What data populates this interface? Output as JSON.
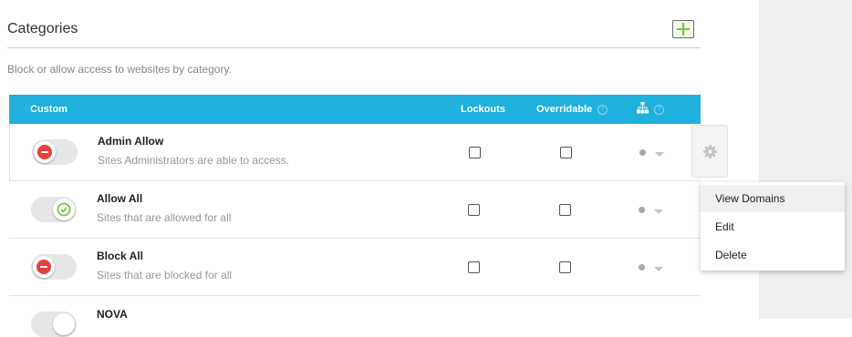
{
  "section": {
    "title": "Categories",
    "description": "Block or allow access to websites by category."
  },
  "table": {
    "columns": {
      "custom": "Custom",
      "lockouts": "Lockouts",
      "overridable": "Overridable"
    },
    "rows": [
      {
        "name": "Admin Allow",
        "description": "Sites Administrators are able to access.",
        "toggle": "block"
      },
      {
        "name": "Allow All",
        "description": "Sites that are allowed for all",
        "toggle": "allow"
      },
      {
        "name": "Block All",
        "description": "Sites that are blocked for all",
        "toggle": "block"
      },
      {
        "name": "NOVA",
        "description": "",
        "toggle": "block"
      }
    ]
  },
  "menu": {
    "items": [
      "View Domains",
      "Edit",
      "Delete"
    ]
  },
  "colors": {
    "header": "#1fb0de",
    "block": "#e5413b",
    "allow": "#7cc242",
    "add": "#7cc242"
  },
  "icons": {
    "add": "plus-icon",
    "hierarchy": "sitemap-icon",
    "help": "question-circle-icon",
    "settings": "gear-icon",
    "block": "minus-circle-icon",
    "allow": "check-circle-icon"
  }
}
